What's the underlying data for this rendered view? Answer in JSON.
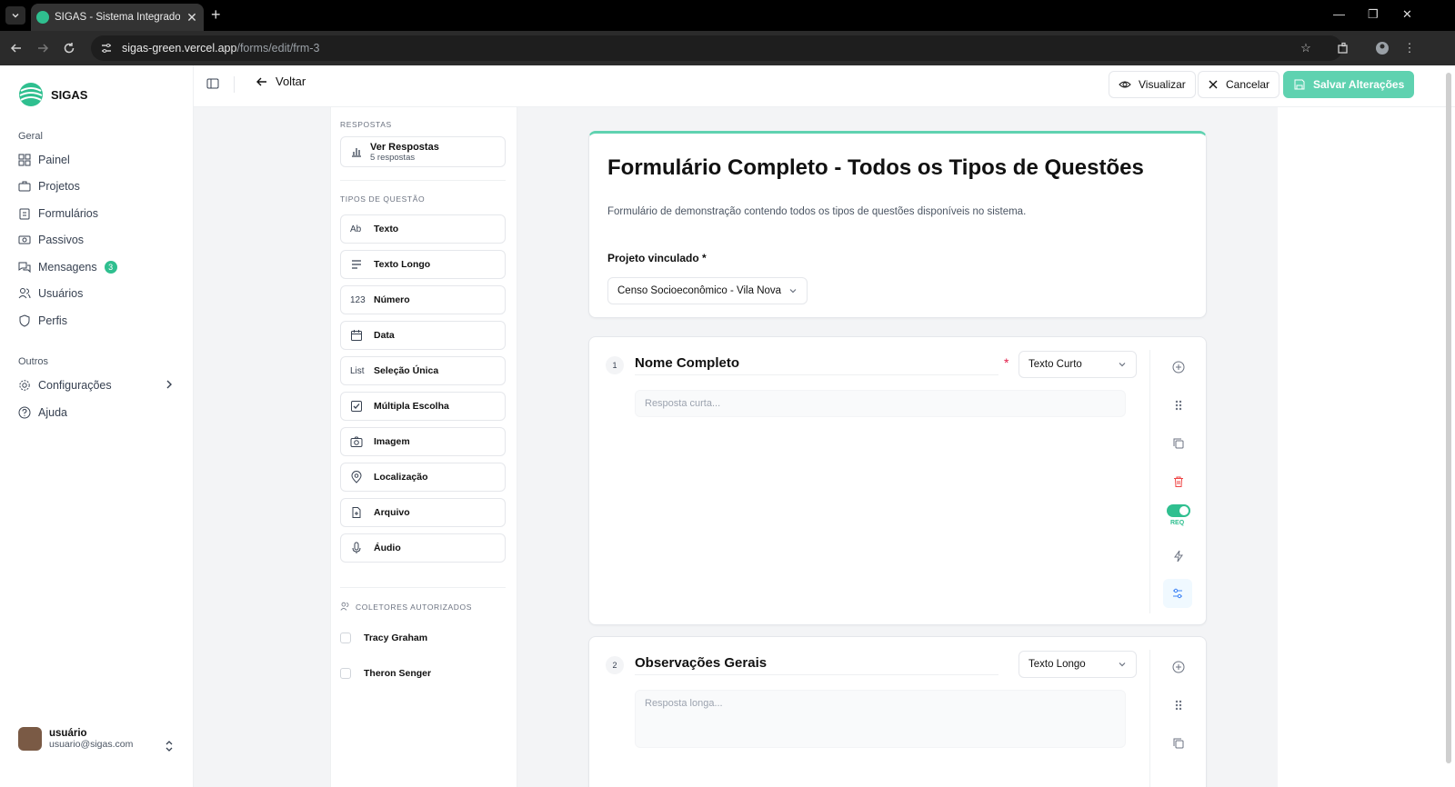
{
  "browser": {
    "tab_title": "SIGAS - Sistema Integrado de G",
    "url_host": "sigas-green.vercel.app",
    "url_path": "/forms/edit/frm-3"
  },
  "sidebar": {
    "brand": "SIGAS",
    "group_general": "Geral",
    "items": [
      {
        "label": "Painel"
      },
      {
        "label": "Projetos"
      },
      {
        "label": "Formulários"
      },
      {
        "label": "Passivos"
      },
      {
        "label": "Mensagens",
        "badge": "3"
      },
      {
        "label": "Usuários"
      },
      {
        "label": "Perfis"
      }
    ],
    "group_other": "Outros",
    "other_items": [
      {
        "label": "Configurações"
      },
      {
        "label": "Ajuda"
      }
    ],
    "user": {
      "name": "usuário",
      "email": "usuario@sigas.com"
    }
  },
  "topbar": {
    "back_label": "Voltar",
    "preview_label": "Visualizar",
    "cancel_label": "Cancelar",
    "save_label": "Salvar Alterações"
  },
  "palette": {
    "responses_heading": "RESPOSTAS",
    "responses_title": "Ver Respostas",
    "responses_count": "5 respostas",
    "types_heading": "TIPOS DE QUESTÃO",
    "types": [
      {
        "icon": "Ab",
        "label": "Texto"
      },
      {
        "icon": "lines-icon",
        "label": "Texto Longo"
      },
      {
        "icon": "123",
        "label": "Número"
      },
      {
        "icon": "calendar-icon",
        "label": "Data"
      },
      {
        "icon": "List",
        "label": "Seleção Única"
      },
      {
        "icon": "checkbox-icon",
        "label": "Múltipla Escolha"
      },
      {
        "icon": "camera-icon",
        "label": "Imagem"
      },
      {
        "icon": "pin-icon",
        "label": "Localização"
      },
      {
        "icon": "file-icon",
        "label": "Arquivo"
      },
      {
        "icon": "mic-icon",
        "label": "Áudio"
      }
    ],
    "collectors_heading": "COLETORES AUTORIZADOS",
    "collectors": [
      {
        "name": "Tracy Graham"
      },
      {
        "name": "Theron Senger"
      }
    ]
  },
  "form": {
    "title": "Formulário Completo - Todos os Tipos de Questões",
    "description": "Formulário de demonstração contendo todos os tipos de questões disponíveis no sistema.",
    "project_label": "Projeto vinculado *",
    "project_value": "Censo Socioeconômico - Vila Nova",
    "questions": [
      {
        "number": "1",
        "title": "Nome Completo",
        "required_mark": "*",
        "type": "Texto Curto",
        "placeholder": "Resposta curta...",
        "req_label": "REQ"
      },
      {
        "number": "2",
        "title": "Observações Gerais",
        "type": "Texto Longo",
        "placeholder": "Resposta longa..."
      }
    ]
  },
  "colors": {
    "accent": "#5fd2b0",
    "badge": "#2fbf8f",
    "danger": "#ef4444"
  }
}
